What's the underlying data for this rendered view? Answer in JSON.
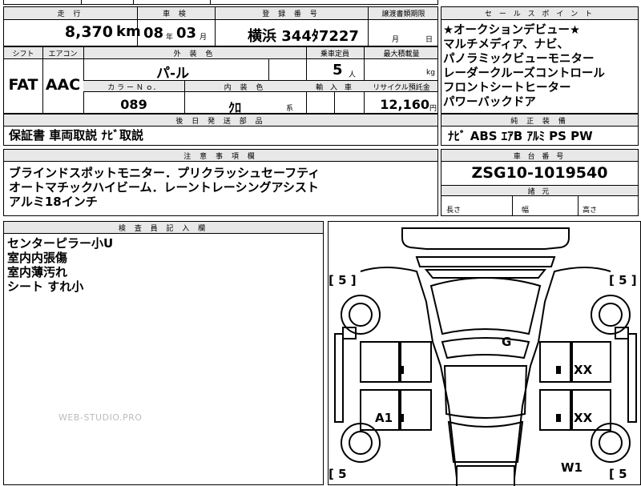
{
  "row1": {
    "mileage_label": "走 行",
    "shaken_label": "車 検",
    "reg_label": "登 録 番 号",
    "transfer_label": "譲渡書類期限",
    "mileage_value": "8,370",
    "mileage_unit": "km",
    "shaken_year": "08",
    "shaken_year_unit": "年",
    "shaken_month": "03",
    "shaken_month_unit": "月",
    "reg_value": "横浜 344ﾀ7227",
    "transfer_month": "月",
    "transfer_day": "日"
  },
  "row2": {
    "shift_label": "シフト",
    "aircon_label": "エアコン",
    "ext_color_label": "外 装 色",
    "capacity_label": "乗車定員",
    "max_load_label": "最大積載量",
    "shift_value": "FAT",
    "aircon_value": "AAC",
    "ext_color_value": "パ-ル",
    "capacity_value": "5",
    "capacity_unit": "人",
    "max_load_unit": "kg",
    "color_no_label": "カ ラ ー Ｎ ｏ．",
    "interior_label": "内 装 色",
    "import_label": "輸 入 車",
    "recycle_label": "リサイクル預託金",
    "color_no_value": "089",
    "interior_value": "ｸﾛ",
    "interior_unit": "系",
    "recycle_value": "12,160",
    "recycle_unit": "円"
  },
  "later": {
    "label": "後 日 発 送 部 品",
    "value": "保証書 車両取説 ﾅﾋﾞ取説"
  },
  "sales": {
    "label": "セ ー ル ス ポ イ ン ト",
    "lines": [
      "★オークションデビュー★",
      "マルチメディア、ナビ、",
      "パノラミックビューモニター",
      "レーダークルーズコントロール",
      "フロントシートヒーター",
      "パワーバックドア"
    ]
  },
  "genuine": {
    "label": "純 正 装 備",
    "value": "ﾅﾋﾞ ABS ｴｱB ｱﾙﾐ PS PW"
  },
  "notes": {
    "label": "注 意 事 項 欄",
    "lines": [
      "ブラインドスポットモニター．プリクラッシュセーフティ",
      "オートマチックハイビーム．レーントレーシングアシスト",
      "アルミ18インチ"
    ]
  },
  "chassis": {
    "label": "車 台 番 号",
    "value": "ZSG10-1019540",
    "spec_label": "諸 元",
    "length_label": "長さ",
    "width_label": "幅",
    "height_label": "高さ"
  },
  "inspector": {
    "label": "検 査 員 記 入 欄",
    "lines": [
      "センターピラー小U",
      "室内内張傷",
      "室内薄汚れ",
      "シート すれ小"
    ]
  },
  "diagram": {
    "tl_tire": "[ 5 ]",
    "tr_tire": "[ 5 ]",
    "bl_tire": "[ 5",
    "br_tire": "[ 5",
    "mark_g": "G",
    "mark_xx1": "XX",
    "mark_xx2": "XX",
    "mark_a1": "A1",
    "mark_w1": "W1"
  },
  "watermark": "WEB-STUDIO.PRO"
}
